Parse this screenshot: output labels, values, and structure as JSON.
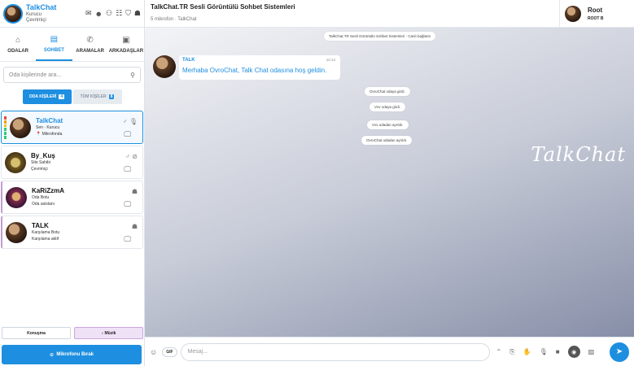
{
  "sidebar": {
    "user": {
      "name": "TalkChat",
      "role": "Kurucu",
      "status": "Çevrimiçi"
    },
    "tabs": [
      {
        "label": "ODALAR",
        "icon": "home-icon"
      },
      {
        "label": "SOHBET",
        "icon": "chat-icon"
      },
      {
        "label": "ARAMALAR",
        "icon": "phone-icon"
      },
      {
        "label": "ARKADAŞLAR",
        "icon": "contacts-icon"
      }
    ],
    "search_placeholder": "Oda kişilerinde ara...",
    "filter_room": "ODA KİŞİLERİ",
    "filter_room_count": "4",
    "filter_all": "TÜM KİŞİLER",
    "filter_all_count": "8",
    "users": [
      {
        "name": "TalkChat",
        "line1": "Sen · Kurucu",
        "line2": "Mikrofonda"
      },
      {
        "name": "By_Kuş",
        "line1": "Site Sahibi",
        "line2": "Çevrimiçi"
      },
      {
        "name": "KaRiZzmA",
        "line1": "Oda Botu",
        "line2": "Oda asistanı"
      },
      {
        "name": "TALK",
        "line1": "Karşılama Botu",
        "line2": "Karşılama aktif"
      }
    ],
    "btn_talk": "Konuşma",
    "btn_music": "Müzik",
    "btn_mic": "Mikrofonu Bırak"
  },
  "header": {
    "title": "TalkChat.TR Sesli Görüntülü Sohbet Sistemleri",
    "subtitle": "5 mikrofon · TalkChat",
    "me_name": "Root",
    "me_badge": "ROOT B"
  },
  "chat": {
    "system_banner": "TalkChat.TR Sesli Görüntülü Sohbet Sistemleri · Canlı bağlantı",
    "message": {
      "from": "TALK",
      "time": "12:14",
      "text": "Merhaba OvroChat, Talk Chat odasına hoş geldin."
    },
    "events": [
      "OvroChat odaya girdi.",
      "Vvv odaya girdi.",
      "Vvv odadan ayrıldı.",
      "OvroChat odadan ayrıldı."
    ],
    "watermark": "TalkChat"
  },
  "composer": {
    "gif": "GIF",
    "placeholder": "Mesaj..."
  },
  "colors": {
    "accent": "#1e8fe0",
    "music": "#efe2f7"
  }
}
